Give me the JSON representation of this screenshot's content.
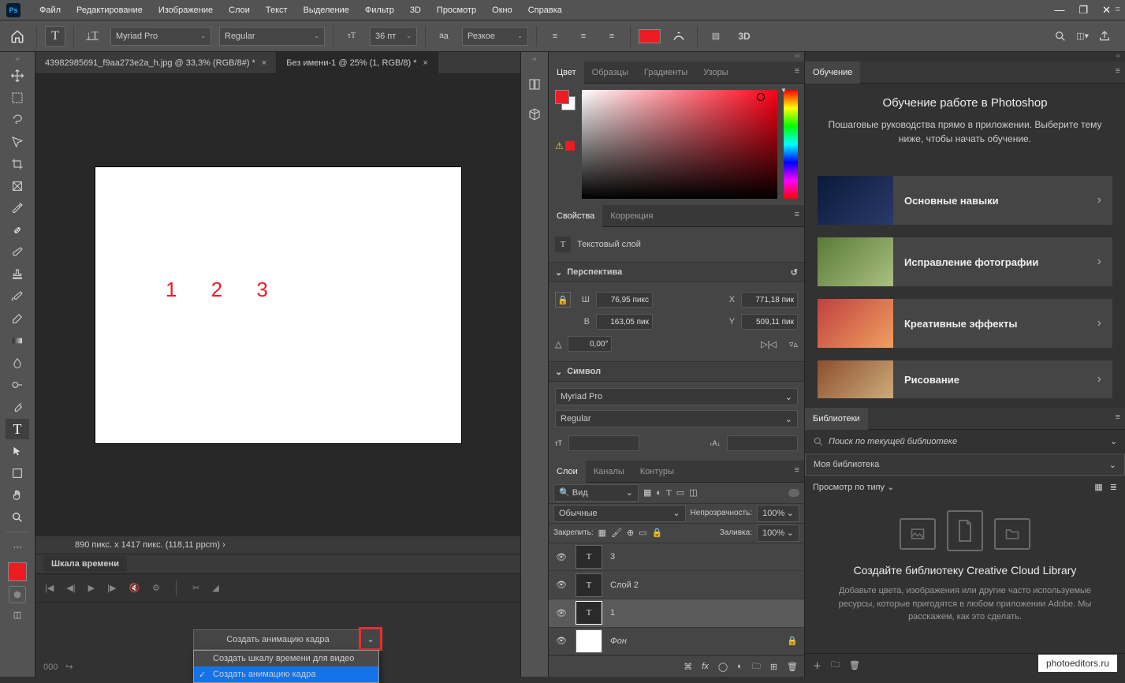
{
  "menubar": {
    "items": [
      "Файл",
      "Редактирование",
      "Изображение",
      "Слои",
      "Текст",
      "Выделение",
      "Фильтр",
      "3D",
      "Просмотр",
      "Окно",
      "Справка"
    ]
  },
  "optionsbar": {
    "font_family": "Myriad Pro",
    "font_style": "Regular",
    "font_size": "36 пт",
    "aa_label": "Резкое"
  },
  "doctabs": [
    {
      "label": "43982985691_f9aa273e2a_h.jpg @ 33,3% (RGB/8#) *",
      "active": false
    },
    {
      "label": "Без имени-1 @ 25% (1, RGB/8) *",
      "active": true
    }
  ],
  "canvas": {
    "text": "1 2 3"
  },
  "statusbar": {
    "text": "890 пикс. x 1417 пикс. (118,11 ppcm) ›"
  },
  "timeline": {
    "title": "Шкала времени",
    "create_label": "Создать анимацию кадра",
    "menu": [
      {
        "label": "Создать шкалу времени для видео",
        "selected": false
      },
      {
        "label": "Создать анимацию кадра",
        "selected": true
      }
    ]
  },
  "panels": {
    "color": {
      "tabs": [
        "Цвет",
        "Образцы",
        "Градиенты",
        "Узоры"
      ]
    },
    "props": {
      "tabs": [
        "Свойства",
        "Коррекция"
      ],
      "type_label": "Текстовый слой",
      "accordion1": "Перспектива",
      "w_label": "Ш",
      "w_val": "76,95 пикс",
      "h_label": "В",
      "h_val": "163,05 пик",
      "x_label": "X",
      "x_val": "771,18 пик",
      "y_label": "Y",
      "y_val": "509,11 пик",
      "angle": "0,00°",
      "accordion2": "Символ",
      "char_font": "Myriad Pro",
      "char_style": "Regular"
    },
    "layers": {
      "tabs": [
        "Слои",
        "Каналы",
        "Контуры"
      ],
      "filter": "Вид",
      "blend": "Обычные",
      "opacity_label": "Непрозрачность:",
      "opacity_val": "100%",
      "lock_label": "Закрепить:",
      "fill_label": "Заливка:",
      "fill_val": "100%",
      "rows": [
        {
          "name": "3",
          "type": "T"
        },
        {
          "name": "Слой 2",
          "type": "T"
        },
        {
          "name": "1",
          "type": "T",
          "selected": true
        },
        {
          "name": "Фон",
          "type": "bg",
          "locked": true
        }
      ]
    }
  },
  "learn": {
    "tab": "Обучение",
    "title": "Обучение работе в Photoshop",
    "sub": "Пошаговые руководства прямо в приложении. Выберите тему ниже, чтобы начать обучение.",
    "cards": [
      "Основные навыки",
      "Исправление фотографии",
      "Креативные эффекты",
      "Рисование"
    ]
  },
  "libs": {
    "tab": "Библиотеки",
    "search_placeholder": "Поиск по текущей библиотеке",
    "selected": "Моя библиотека",
    "view_label": "Просмотр по типу",
    "empty_title": "Создайте библиотеку Creative Cloud Library",
    "empty_sub": "Добавьте цвета, изображения или другие часто используемые ресурсы, которые пригодятся в любом приложении Adobe. Мы расскажем, как это сделать."
  },
  "watermark": "photoeditors.ru"
}
